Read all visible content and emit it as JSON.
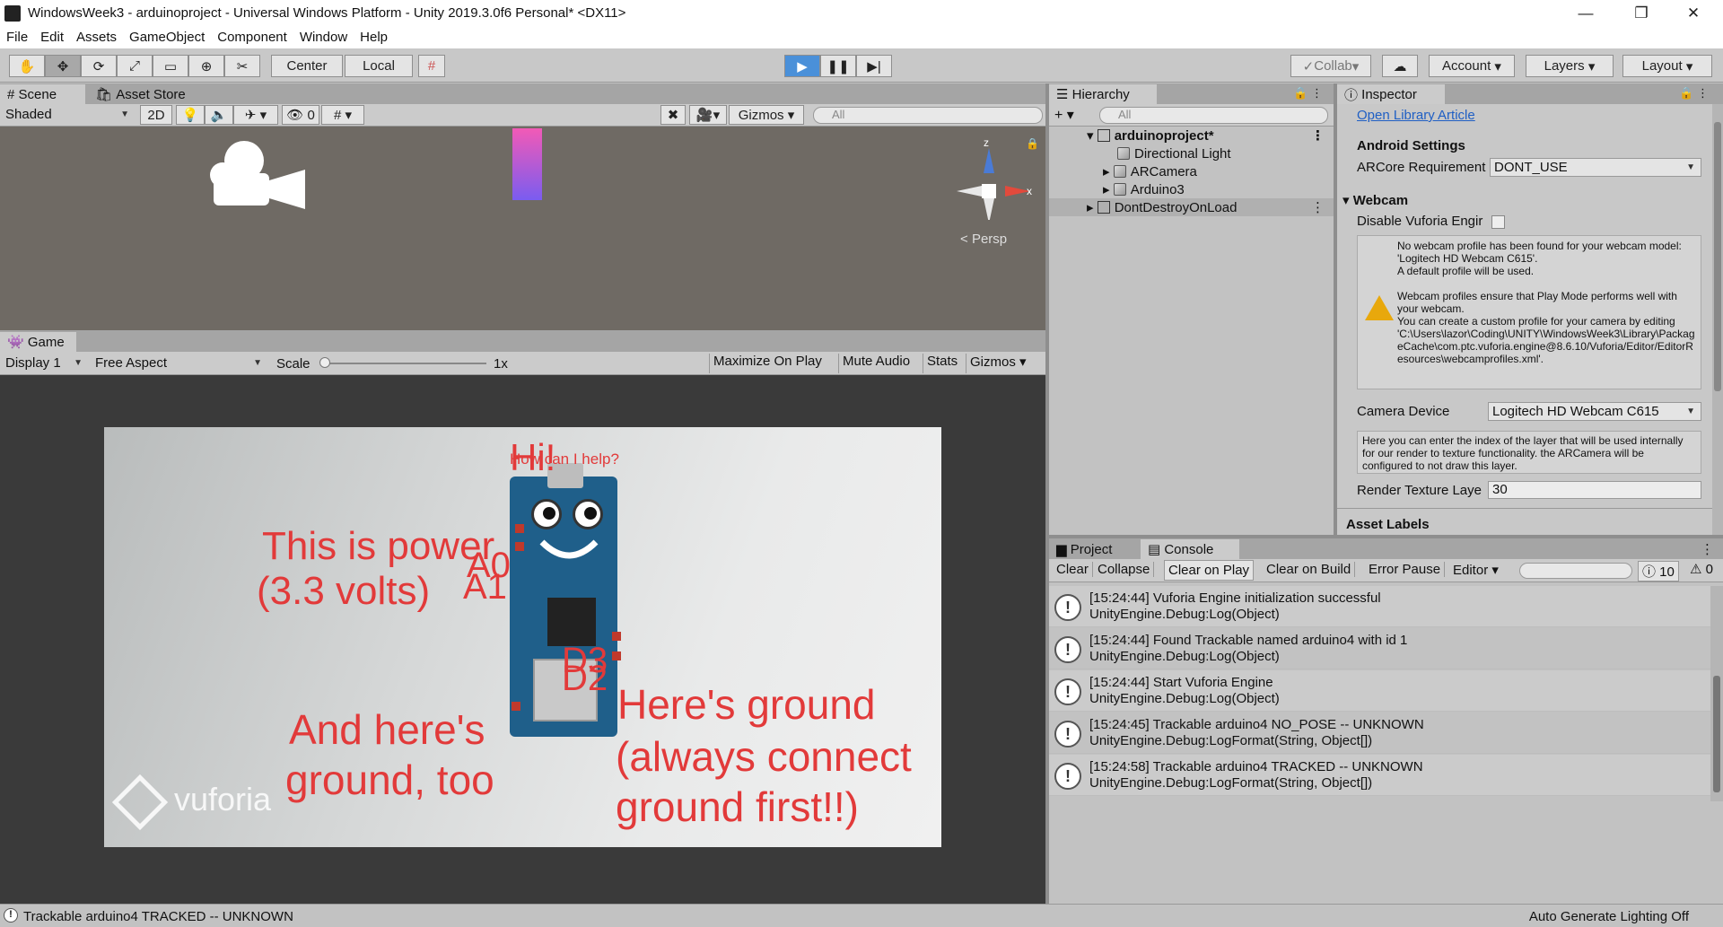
{
  "window": {
    "title": "WindowsWeek3 - arduinoproject - Universal Windows Platform - Unity 2019.3.0f6 Personal* <DX11>",
    "controls": {
      "minimize": "—",
      "restore": "❐",
      "close": "✕"
    }
  },
  "menu": [
    "File",
    "Edit",
    "Assets",
    "GameObject",
    "Component",
    "Window",
    "Help"
  ],
  "toolbar": {
    "pivot_center": "Center",
    "pivot_local": "Local",
    "collab": "Collab",
    "account": "Account",
    "layers": "Layers",
    "layout": "Layout"
  },
  "scene": {
    "tabs": [
      "Scene",
      "Asset Store"
    ],
    "shading": "Shaded",
    "mode_2d": "2D",
    "hidden_count": "0",
    "gizmos": "Gizmos",
    "search_placeholder": "All",
    "persp_label": "Persp",
    "axis_z": "z",
    "axis_x": "x"
  },
  "game": {
    "tab": "Game",
    "display": "Display 1",
    "aspect": "Free Aspect",
    "scale_label": "Scale",
    "scale_value": "1x",
    "maximize": "Maximize On Play",
    "mute": "Mute Audio",
    "stats": "Stats",
    "gizmos": "Gizmos",
    "overlay": {
      "hi": "Hi!",
      "help": "How can I help?",
      "power_line1": "This is power",
      "power_line2": "(3.3 volts)",
      "a0": "A0",
      "a1": "A1",
      "d3": "D3",
      "d2": "D2",
      "ground_line1": "Here's ground",
      "ground_line2": "(always connect",
      "ground_line3": "ground first!!)",
      "ground2_line1": "And here's",
      "ground2_line2": "ground, too",
      "watermark": "vuforia"
    }
  },
  "hierarchy": {
    "tab": "Hierarchy",
    "search_placeholder": "All",
    "items": [
      {
        "label": "arduinoproject*",
        "level": 0
      },
      {
        "label": "Directional Light",
        "level": 1
      },
      {
        "label": "ARCamera",
        "level": 1
      },
      {
        "label": "Arduino3",
        "level": 1
      },
      {
        "label": "DontDestroyOnLoad",
        "level": 0
      }
    ]
  },
  "inspector": {
    "tab": "Inspector",
    "open_library": "Open Library Article",
    "android_settings": "Android Settings",
    "arcore_label": "ARCore Requirement",
    "arcore_value": "DONT_USE",
    "webcam_header": "Webcam",
    "disable_vuforia_label": "Disable Vuforia Engir",
    "webcam_help_1": "No webcam profile has been found for your webcam model: 'Logitech HD Webcam C615'.",
    "webcam_help_2": "A default profile will be used.",
    "webcam_help_3": "Webcam profiles ensure that Play Mode performs well with your webcam.",
    "webcam_help_4": "You can create a custom profile for your camera by editing 'C:\\Users\\lazor\\Coding\\UNITY\\WindowsWeek3\\Library\\PackageCache\\com.ptc.vuforia.engine@8.6.10/Vuforia/Editor/EditorResources\\webcamprofiles.xml'.",
    "camera_device_label": "Camera Device",
    "camera_device_value": "Logitech HD Webcam C615",
    "render_help": "Here you can enter the index of the layer that will be used internally for our render to texture functionality. the ARCamera will be configured to not draw this layer.",
    "render_layer_label": "Render Texture Laye",
    "render_layer_value": "30",
    "asset_labels": "Asset Labels"
  },
  "console": {
    "tabs": [
      "Project",
      "Console"
    ],
    "buttons": [
      "Clear",
      "Collapse",
      "Clear on Play",
      "Clear on Build",
      "Error Pause",
      "Editor"
    ],
    "info_count": "10",
    "warn_count": "0",
    "entries": [
      {
        "line1": "[15:24:44] Vuforia Engine initialization successful",
        "line2": "UnityEngine.Debug:Log(Object)"
      },
      {
        "line1": "[15:24:44] Found Trackable named arduino4 with id 1",
        "line2": "UnityEngine.Debug:Log(Object)"
      },
      {
        "line1": "[15:24:44] Start Vuforia Engine",
        "line2": "UnityEngine.Debug:Log(Object)"
      },
      {
        "line1": "[15:24:45] Trackable arduino4 NO_POSE -- UNKNOWN",
        "line2": "UnityEngine.Debug:LogFormat(String, Object[])"
      },
      {
        "line1": "[15:24:58] Trackable arduino4 TRACKED -- UNKNOWN",
        "line2": "UnityEngine.Debug:LogFormat(String, Object[])"
      }
    ]
  },
  "status": {
    "message": "Trackable arduino4 TRACKED -- UNKNOWN",
    "right": "Auto Generate Lighting Off"
  },
  "colors": {
    "accent": "#4a90d9",
    "overlay_red": "#e23a3a"
  }
}
